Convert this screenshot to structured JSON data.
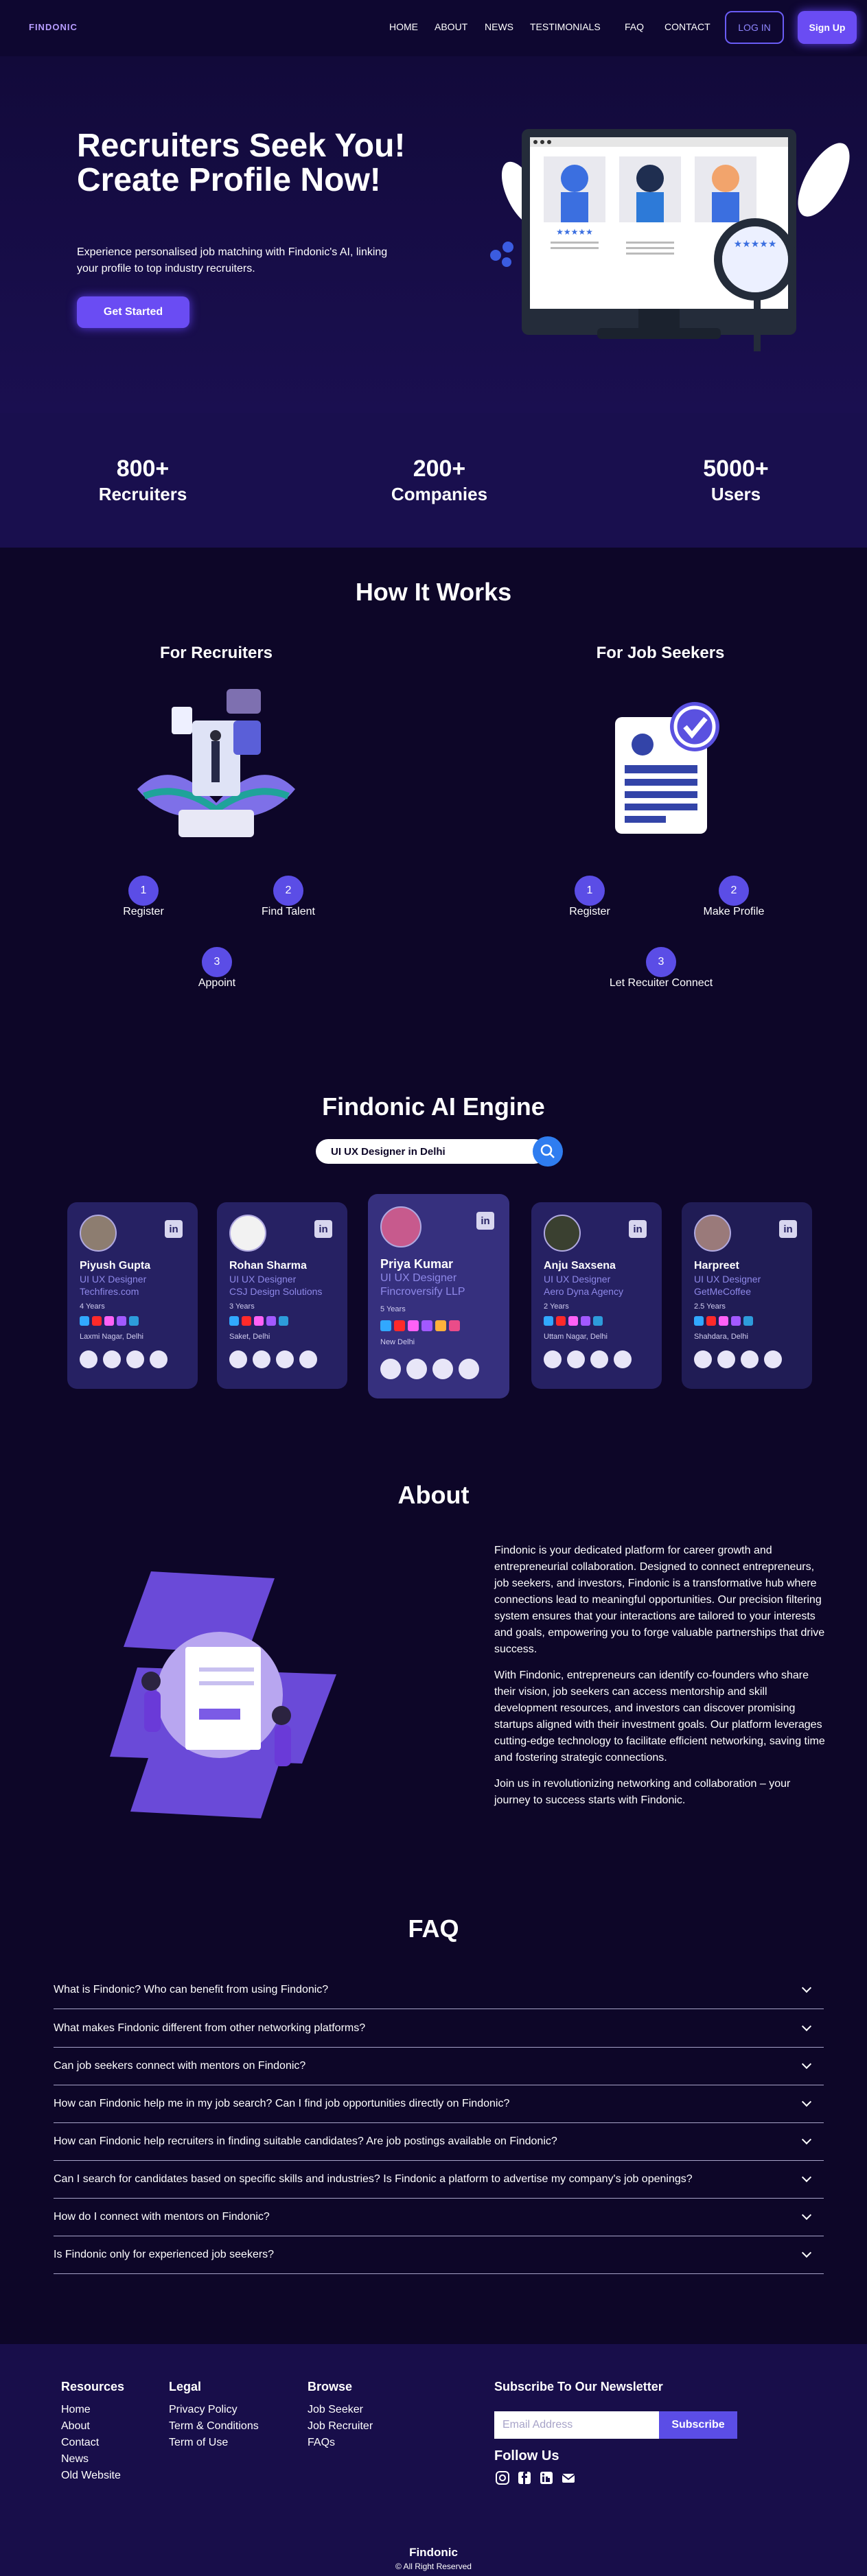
{
  "nav": {
    "logo": "FINDONIC",
    "links": [
      "HOME",
      "ABOUT",
      "NEWS",
      "TESTIMONIALS",
      "FAQ",
      "CONTACT"
    ],
    "login": "LOG IN",
    "signup": "Sign Up"
  },
  "hero": {
    "title": "Recruiters Seek You! Create Profile Now!",
    "description": "Experience personalised job matching with Findonic's AI, linking your profile to top industry recruiters.",
    "cta": "Get Started"
  },
  "stats": [
    {
      "number": "800+",
      "label": "Recruiters"
    },
    {
      "number": "200+",
      "label": "Companies"
    },
    {
      "number": "5000+",
      "label": "Users"
    }
  ],
  "how": {
    "title": "How It Works",
    "recruiters": {
      "title": "For Recruiters",
      "steps": [
        {
          "num": "1",
          "label": "Register"
        },
        {
          "num": "2",
          "label": "Find Talent"
        },
        {
          "num": "3",
          "label": "Appoint"
        }
      ]
    },
    "seekers": {
      "title": "For Job Seekers",
      "steps": [
        {
          "num": "1",
          "label": "Register"
        },
        {
          "num": "2",
          "label": "Make Profile"
        },
        {
          "num": "3",
          "label": "Let Recuiter Connect"
        }
      ]
    }
  },
  "engine": {
    "title": "Findonic AI Engine",
    "search_value": "UI UX Designer in Delhi",
    "cards": [
      {
        "name": "Piyush Gupta",
        "role": "UI UX Designer",
        "company": "Techfires.com",
        "exp": "4 Years",
        "location": "Laxmi Nagar, Delhi"
      },
      {
        "name": "Rohan Sharma",
        "role": "UI UX Designer",
        "company": "CSJ Design Solutions",
        "exp": "3 Years",
        "location": "Saket, Delhi"
      },
      {
        "name": "Priya Kumar",
        "role": "UI UX Designer",
        "company": "Fincroversify LLP",
        "exp": "5 Years",
        "location": "New Delhi"
      },
      {
        "name": "Anju Saxsena",
        "role": "UI UX Designer",
        "company": "Aero Dyna Agency",
        "exp": "2 Years",
        "location": "Uttam Nagar, Delhi"
      },
      {
        "name": "Harpreet",
        "role": "UI UX Designer",
        "company": "GetMeCoffee",
        "exp": "2.5 Years",
        "location": "Shahdara, Delhi"
      }
    ]
  },
  "about": {
    "title": "About",
    "paragraphs": [
      "Findonic is your dedicated platform for career growth and entrepreneurial collaboration. Designed to connect entrepreneurs, job seekers, and investors, Findonic is a transformative hub where connections lead to meaningful opportunities. Our precision filtering system ensures that your interactions are tailored to your interests and goals, empowering you to forge valuable partnerships that drive success.",
      "With Findonic, entrepreneurs can identify co-founders who share their vision, job seekers can access mentorship and skill development resources, and investors can discover promising startups aligned with their investment goals. Our platform leverages cutting-edge technology to facilitate efficient networking, saving time and fostering strategic connections.",
      "Join us in revolutionizing networking and collaboration – your journey to success starts with Findonic."
    ]
  },
  "faq": {
    "title": "FAQ",
    "items": [
      "What is Findonic? Who can benefit from using Findonic?",
      "What makes Findonic different from other networking platforms?",
      "Can job seekers connect with mentors on Findonic?",
      "How can Findonic help me in my job search? Can I find job opportunities directly on Findonic?",
      "How can Findonic help recruiters in finding suitable candidates? Are job postings available on Findonic?",
      "Can I search for candidates based on specific skills and industries? Is Findonic a platform to advertise my company's job openings?",
      "How do I connect with mentors on Findonic?",
      "Is Findonic only for experienced job seekers?"
    ]
  },
  "footer": {
    "resources": {
      "title": "Resources",
      "links": [
        "Home",
        "About",
        "Contact",
        "News",
        "Old Website"
      ]
    },
    "legal": {
      "title": "Legal",
      "links": [
        "Privacy Policy",
        "Term & Conditions",
        "Term of Use"
      ]
    },
    "browse": {
      "title": "Browse",
      "links": [
        "Job Seeker",
        "Job Recruiter",
        "FAQs"
      ]
    },
    "newsletter": {
      "title": "Subscribe To Our Newsletter",
      "placeholder": "Email Address",
      "button": "Subscribe"
    },
    "follow": "Follow Us",
    "brand": "Findonic",
    "copyright": "© All Right Reserved"
  },
  "colors": {
    "background": "#0d0628",
    "accent": "#6a4cf3",
    "card": "#262163",
    "link": "#8e88e8"
  }
}
